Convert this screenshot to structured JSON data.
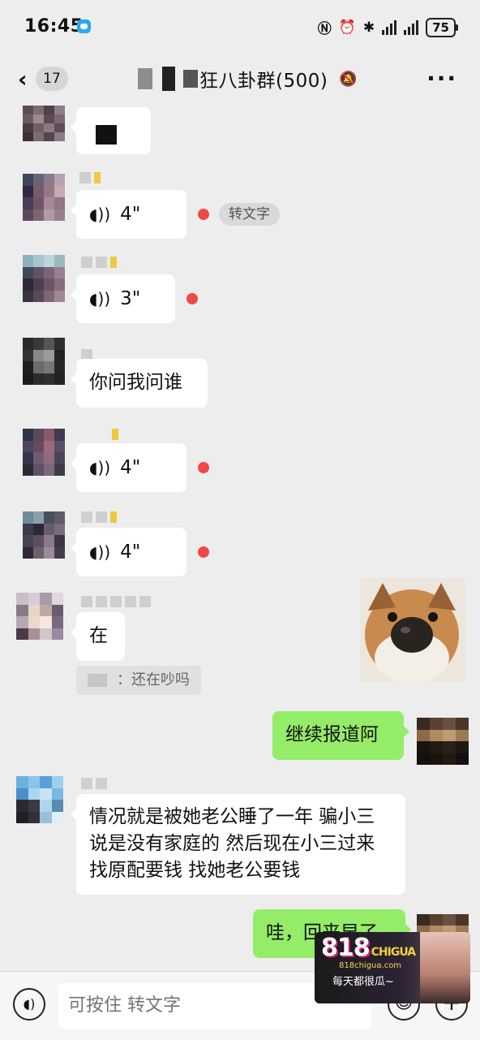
{
  "status_bar": {
    "time": "16:45",
    "battery": "75"
  },
  "nav": {
    "back_chevron": "‹",
    "unread_count": "17",
    "title": "狂八卦群(500)",
    "more": "···"
  },
  "messages": {
    "m1_text": "",
    "m2_duration": "4\"",
    "m2_chip": "转文字",
    "m3_duration": "3\"",
    "m4_text": "你问我问谁",
    "m5_duration": "4\"",
    "m6_duration": "4\"",
    "m7_text": "在",
    "m7_quote": "：还在吵吗",
    "m9_text": "继续报道阿",
    "m10_text": "情况就是被她老公睡了一年 骗小三说是没有家庭的 然后现在小三过来找原配要钱 找她老公要钱",
    "m11_text": "哇，回来早了"
  },
  "input": {
    "placeholder": "可按住 转文字"
  },
  "icons": {
    "voice": "voice-icon",
    "emoji": "emoji-icon",
    "plus": "plus-icon",
    "mute": "mute-bell-icon",
    "wave": "sound-wave-icon"
  },
  "watermark": {
    "logo": "818",
    "logo_sub": "CHIGUA",
    "url": "818chigua.com",
    "slogan": "每天都很瓜~"
  },
  "colors": {
    "background": "#ededed",
    "self_bubble": "#95ec69",
    "other_bubble": "#ffffff",
    "unread_dot": "#f04848"
  }
}
